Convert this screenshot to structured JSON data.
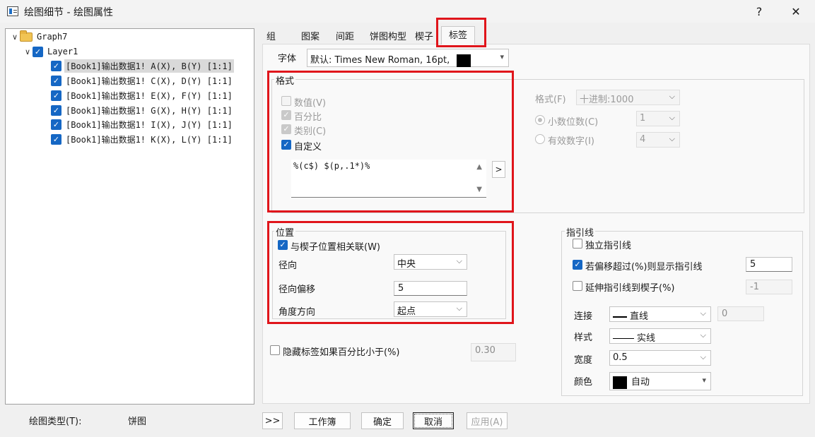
{
  "window": {
    "title": "绘图细节 - 绘图属性",
    "help": "?",
    "close": "✕"
  },
  "tree": {
    "root": "Graph7",
    "layer": "Layer1",
    "items": [
      "[Book1]输出数据1! A(X), B(Y) [1:1]",
      "[Book1]输出数据1! C(X), D(Y) [1:1]",
      "[Book1]输出数据1! E(X), F(Y) [1:1]",
      "[Book1]输出数据1! G(X), H(Y) [1:1]",
      "[Book1]输出数据1! I(X), J(Y) [1:1]",
      "[Book1]输出数据1! K(X), L(Y) [1:1]"
    ],
    "selected_index": 0
  },
  "tabs": [
    "组",
    "图案",
    "间距",
    "饼图构型",
    "楔子",
    "标签"
  ],
  "active_tab": "标签",
  "font": {
    "label": "字体",
    "value": "默认: Times New Roman, 16pt,",
    "color": "#000000"
  },
  "format": {
    "title": "格式",
    "value_cb": "数值(V)",
    "percent_cb": "百分比",
    "category_cb": "类别(C)",
    "custom_cb": "自定义",
    "custom_text": "%(c$) $(p,.1*)%",
    "more_btn": ">",
    "format_label": "格式(F)",
    "format_value": "十进制:1000",
    "decimal_label": "小数位数(C)",
    "decimal_value": "1",
    "sig_label": "有效数字(I)",
    "sig_value": "4"
  },
  "position": {
    "title": "位置",
    "assoc_cb": "与楔子位置相关联(W)",
    "radial_label": "径向",
    "radial_value": "中央",
    "offset_label": "径向偏移",
    "offset_value": "5",
    "angle_label": "角度方向",
    "angle_value": "起点"
  },
  "hide": {
    "label": "隐藏标签如果百分比小于(%)",
    "value": "0.30"
  },
  "leader": {
    "title": "指引线",
    "independent_cb": "独立指引线",
    "show_cb": "若偏移超过(%)则显示指引线",
    "show_value": "5",
    "extend_cb": "延伸指引线到楔子(%)",
    "extend_value": "-1",
    "connect_label": "连接",
    "connect_value": "直线",
    "connect_extra": "0",
    "style_label": "样式",
    "style_value": "实线",
    "width_label": "宽度",
    "width_value": "0.5",
    "color_label": "颜色",
    "color_value": "自动",
    "color_swatch": "#000000"
  },
  "footer": {
    "plot_type_label": "绘图类型(T):",
    "plot_type_value": "饼图",
    "expand": ">>",
    "workbook": "工作簿",
    "ok": "确定",
    "cancel": "取消",
    "apply": "应用(A)"
  },
  "highlight_color": "#e0151b"
}
